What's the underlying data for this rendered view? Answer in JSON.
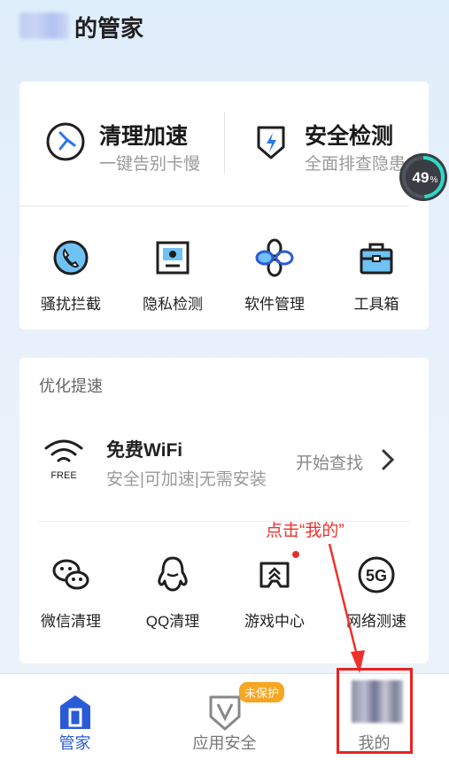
{
  "header": {
    "title": "的管家"
  },
  "primary_features": [
    {
      "title": "清理加速",
      "subtitle": "一键告别卡慢",
      "icon": "speed-clean-icon"
    },
    {
      "title": "安全检测",
      "subtitle": "全面排查隐患",
      "icon": "security-shield-icon"
    }
  ],
  "gauge": {
    "value": "49",
    "unit": "%"
  },
  "tools": [
    {
      "label": "骚扰拦截",
      "icon": "phone-block-icon"
    },
    {
      "label": "隐私检测",
      "icon": "privacy-scan-icon"
    },
    {
      "label": "软件管理",
      "icon": "app-manage-icon"
    },
    {
      "label": "工具箱",
      "icon": "toolbox-icon"
    }
  ],
  "optimize": {
    "section_title": "优化提速",
    "wifi": {
      "title": "免费WiFi",
      "subtitle": "安全|可加速|无需安装",
      "action": "开始查找",
      "icon_label": "FREE"
    },
    "items": [
      {
        "label": "微信清理",
        "icon": "wechat-icon"
      },
      {
        "label": "QQ清理",
        "icon": "qq-penguin-icon"
      },
      {
        "label": "游戏中心",
        "icon": "game-center-icon"
      },
      {
        "label": "网络测速",
        "icon": "5g-icon",
        "icon_text": "5G"
      }
    ]
  },
  "annotation": "点击“我的”",
  "tabbar": {
    "tabs": [
      {
        "label": "管家",
        "active": true
      },
      {
        "label": "应用安全",
        "badge": "未保护"
      },
      {
        "label": "我的"
      }
    ]
  },
  "colors": {
    "brand": "#2a5bd7",
    "accent_blue": "#3b6fe0",
    "annotation_red": "#f0302a",
    "badge_orange": "#f5a623"
  }
}
